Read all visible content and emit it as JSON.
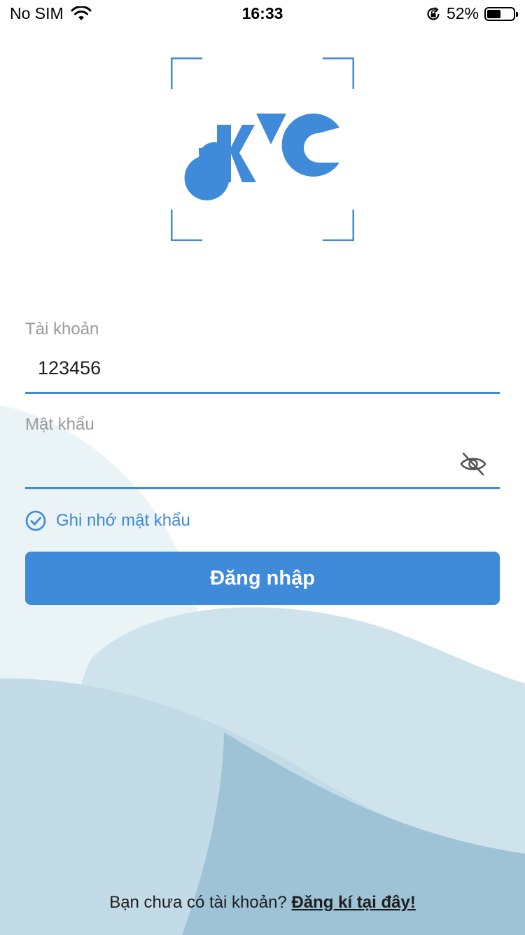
{
  "status_bar": {
    "carrier": "No SIM",
    "time": "16:33",
    "battery": "52%",
    "battery_level": 0.52
  },
  "logo": {
    "text": "eKYC",
    "color": "#3f8ad9"
  },
  "form": {
    "account_label": "Tài khoản",
    "account_value": "123456",
    "password_label": "Mật khẩu",
    "password_value": "",
    "remember_label": "Ghi nhớ mật khẩu",
    "remember_checked": true,
    "login_label": "Đăng nhập"
  },
  "footer": {
    "prompt": "Bạn chưa có tài khoản?",
    "link": "Đăng kí tại đây!"
  },
  "colors": {
    "accent": "#3f8ad9",
    "label_gray": "#9a9a9a",
    "text_dark": "#1e1e1e"
  }
}
